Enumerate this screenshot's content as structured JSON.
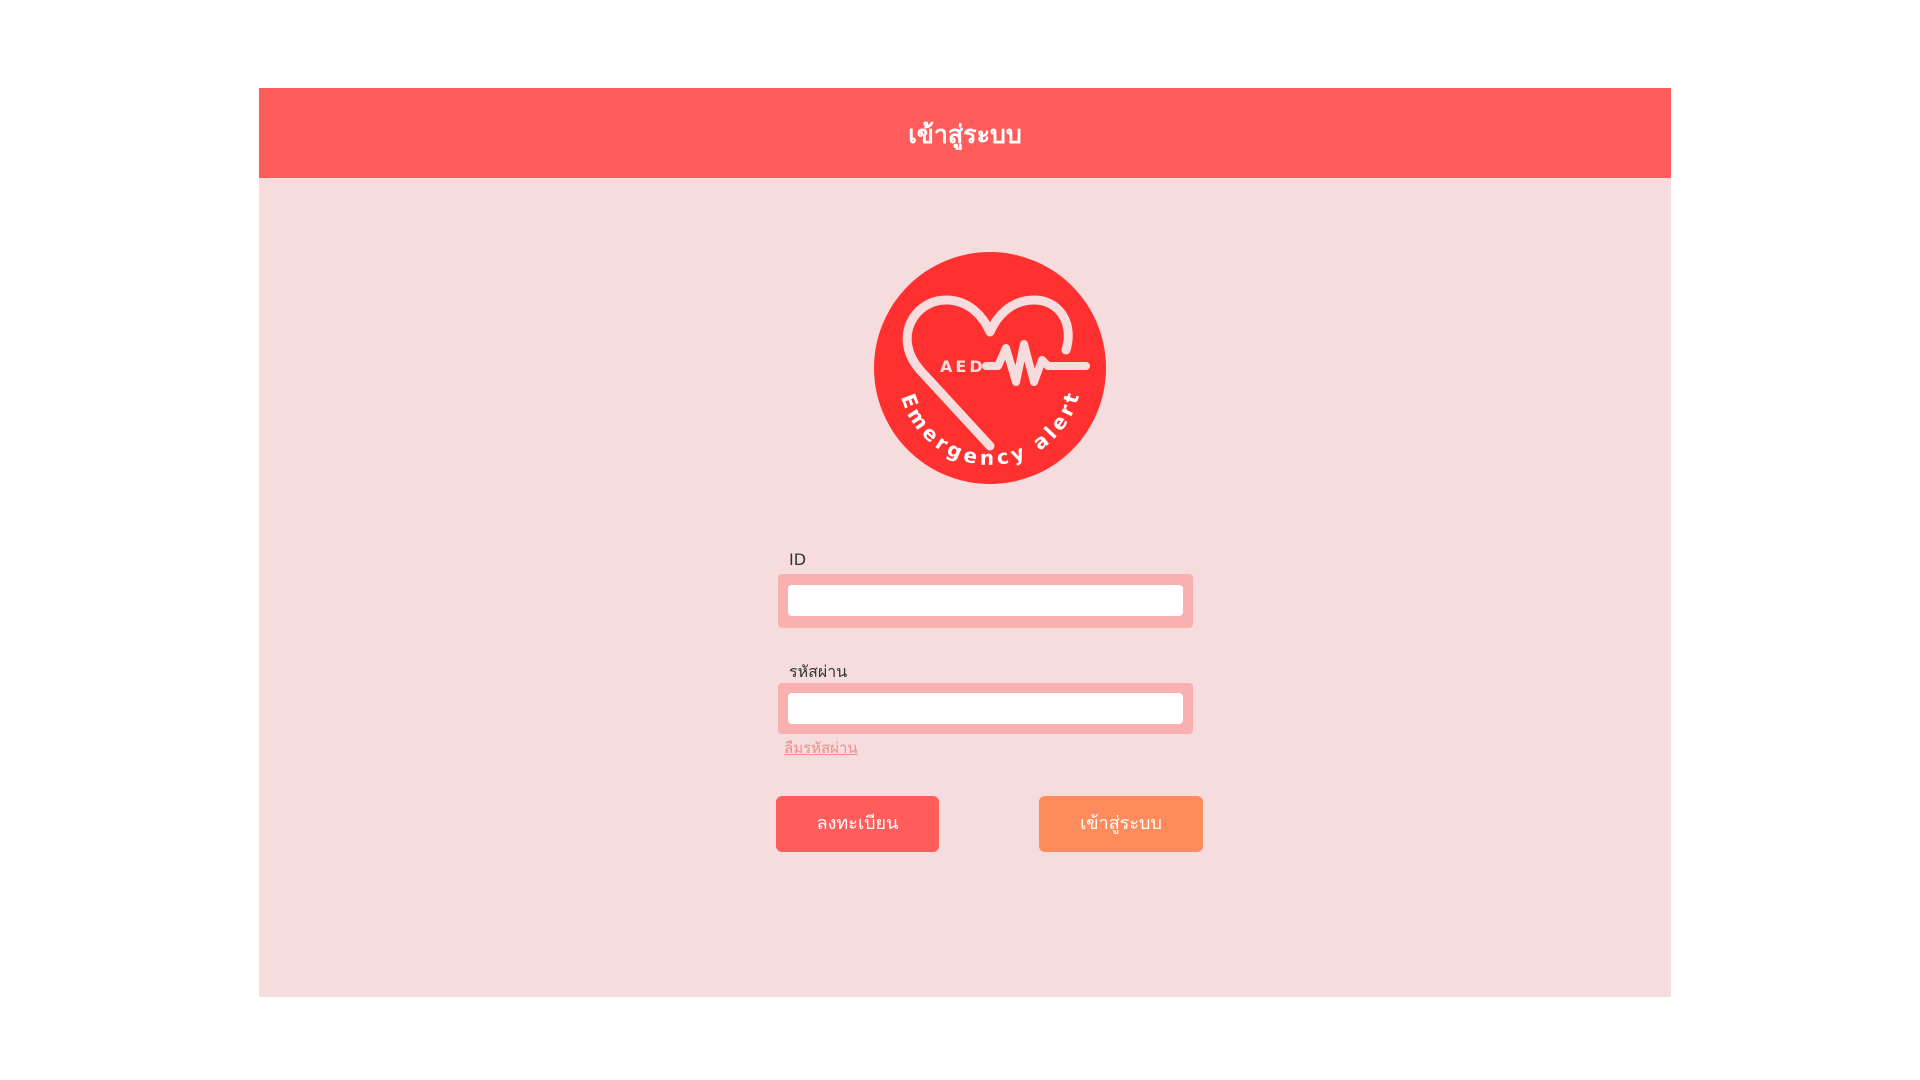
{
  "header": {
    "title": "เข้าสู่ระบบ"
  },
  "logo": {
    "name": "AED Emergency alert logo",
    "text_top": "AED",
    "text_arc": "Emergency alert",
    "color": "#ff3030"
  },
  "form": {
    "id_label": "ID",
    "id_value": "",
    "password_label": "รหัสผ่าน",
    "password_value": "",
    "forgot_password": "ลืมรหัสผ่าน"
  },
  "buttons": {
    "register_label": "ลงทะเบียน",
    "login_label": "เข้าสู่ระบบ"
  },
  "colors": {
    "header": "#ff5c5c",
    "panel_background": "#f6dcdc",
    "field_frame": "#f8b0b0",
    "register_button": "#ff5c5c",
    "login_button": "#ff8b5c"
  }
}
